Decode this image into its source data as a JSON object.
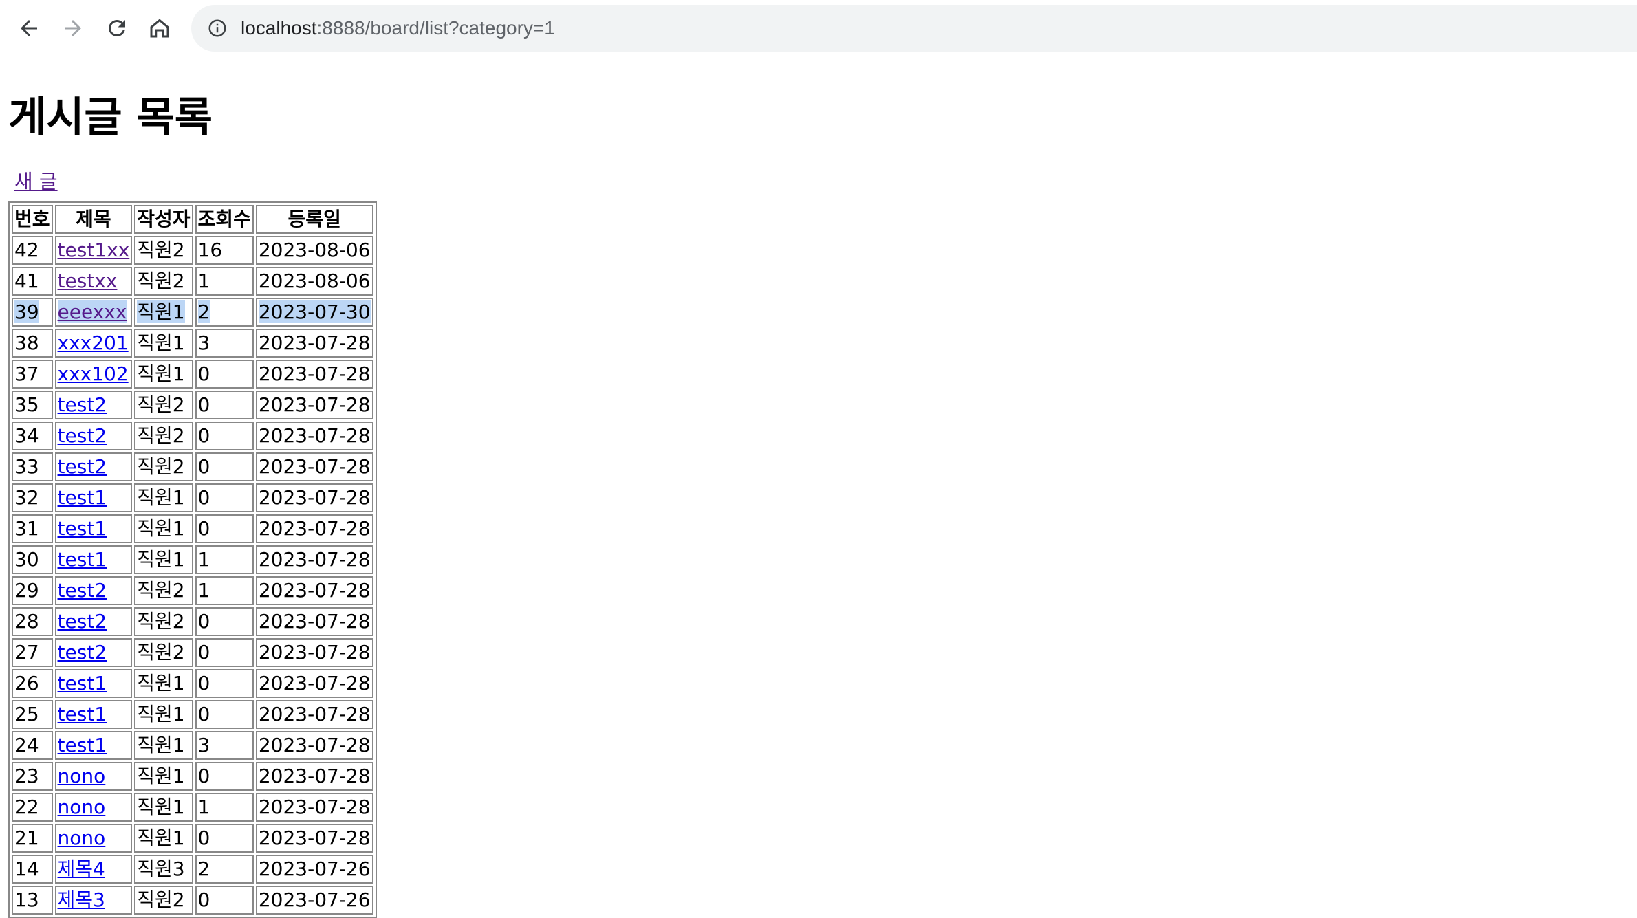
{
  "browser": {
    "url_host": "localhost",
    "url_rest": ":8888/board/list?category=1"
  },
  "page": {
    "title": "게시글 목록",
    "new_post_label": "새 글"
  },
  "table": {
    "headers": [
      "번호",
      "제목",
      "작성자",
      "조회수",
      "등록일"
    ],
    "rows": [
      {
        "no": "42",
        "title": "test1xx",
        "author": "직원2",
        "views": "16",
        "date": "2023-08-06",
        "visited": true
      },
      {
        "no": "41",
        "title": "testxx",
        "author": "직원2",
        "views": "1",
        "date": "2023-08-06",
        "visited": true
      },
      {
        "no": "39",
        "title": "eeexxx",
        "author": "직원1",
        "views": "2",
        "date": "2023-07-30",
        "visited": true,
        "selected": true
      },
      {
        "no": "38",
        "title": "xxx201",
        "author": "직원1",
        "views": "3",
        "date": "2023-07-28"
      },
      {
        "no": "37",
        "title": "xxx102",
        "author": "직원1",
        "views": "0",
        "date": "2023-07-28"
      },
      {
        "no": "35",
        "title": "test2",
        "author": "직원2",
        "views": "0",
        "date": "2023-07-28"
      },
      {
        "no": "34",
        "title": "test2",
        "author": "직원2",
        "views": "0",
        "date": "2023-07-28"
      },
      {
        "no": "33",
        "title": "test2",
        "author": "직원2",
        "views": "0",
        "date": "2023-07-28"
      },
      {
        "no": "32",
        "title": "test1",
        "author": "직원1",
        "views": "0",
        "date": "2023-07-28"
      },
      {
        "no": "31",
        "title": "test1",
        "author": "직원1",
        "views": "0",
        "date": "2023-07-28"
      },
      {
        "no": "30",
        "title": "test1",
        "author": "직원1",
        "views": "1",
        "date": "2023-07-28"
      },
      {
        "no": "29",
        "title": "test2",
        "author": "직원2",
        "views": "1",
        "date": "2023-07-28"
      },
      {
        "no": "28",
        "title": "test2",
        "author": "직원2",
        "views": "0",
        "date": "2023-07-28"
      },
      {
        "no": "27",
        "title": "test2",
        "author": "직원2",
        "views": "0",
        "date": "2023-07-28"
      },
      {
        "no": "26",
        "title": "test1",
        "author": "직원1",
        "views": "0",
        "date": "2023-07-28"
      },
      {
        "no": "25",
        "title": "test1",
        "author": "직원1",
        "views": "0",
        "date": "2023-07-28"
      },
      {
        "no": "24",
        "title": "test1",
        "author": "직원1",
        "views": "3",
        "date": "2023-07-28"
      },
      {
        "no": "23",
        "title": "nono",
        "author": "직원1",
        "views": "0",
        "date": "2023-07-28"
      },
      {
        "no": "22",
        "title": "nono",
        "author": "직원1",
        "views": "1",
        "date": "2023-07-28"
      },
      {
        "no": "21",
        "title": "nono",
        "author": "직원1",
        "views": "0",
        "date": "2023-07-28"
      },
      {
        "no": "14",
        "title": "제목4",
        "author": "직원3",
        "views": "2",
        "date": "2023-07-26"
      },
      {
        "no": "13",
        "title": "제목3",
        "author": "직원2",
        "views": "0",
        "date": "2023-07-26"
      }
    ]
  }
}
